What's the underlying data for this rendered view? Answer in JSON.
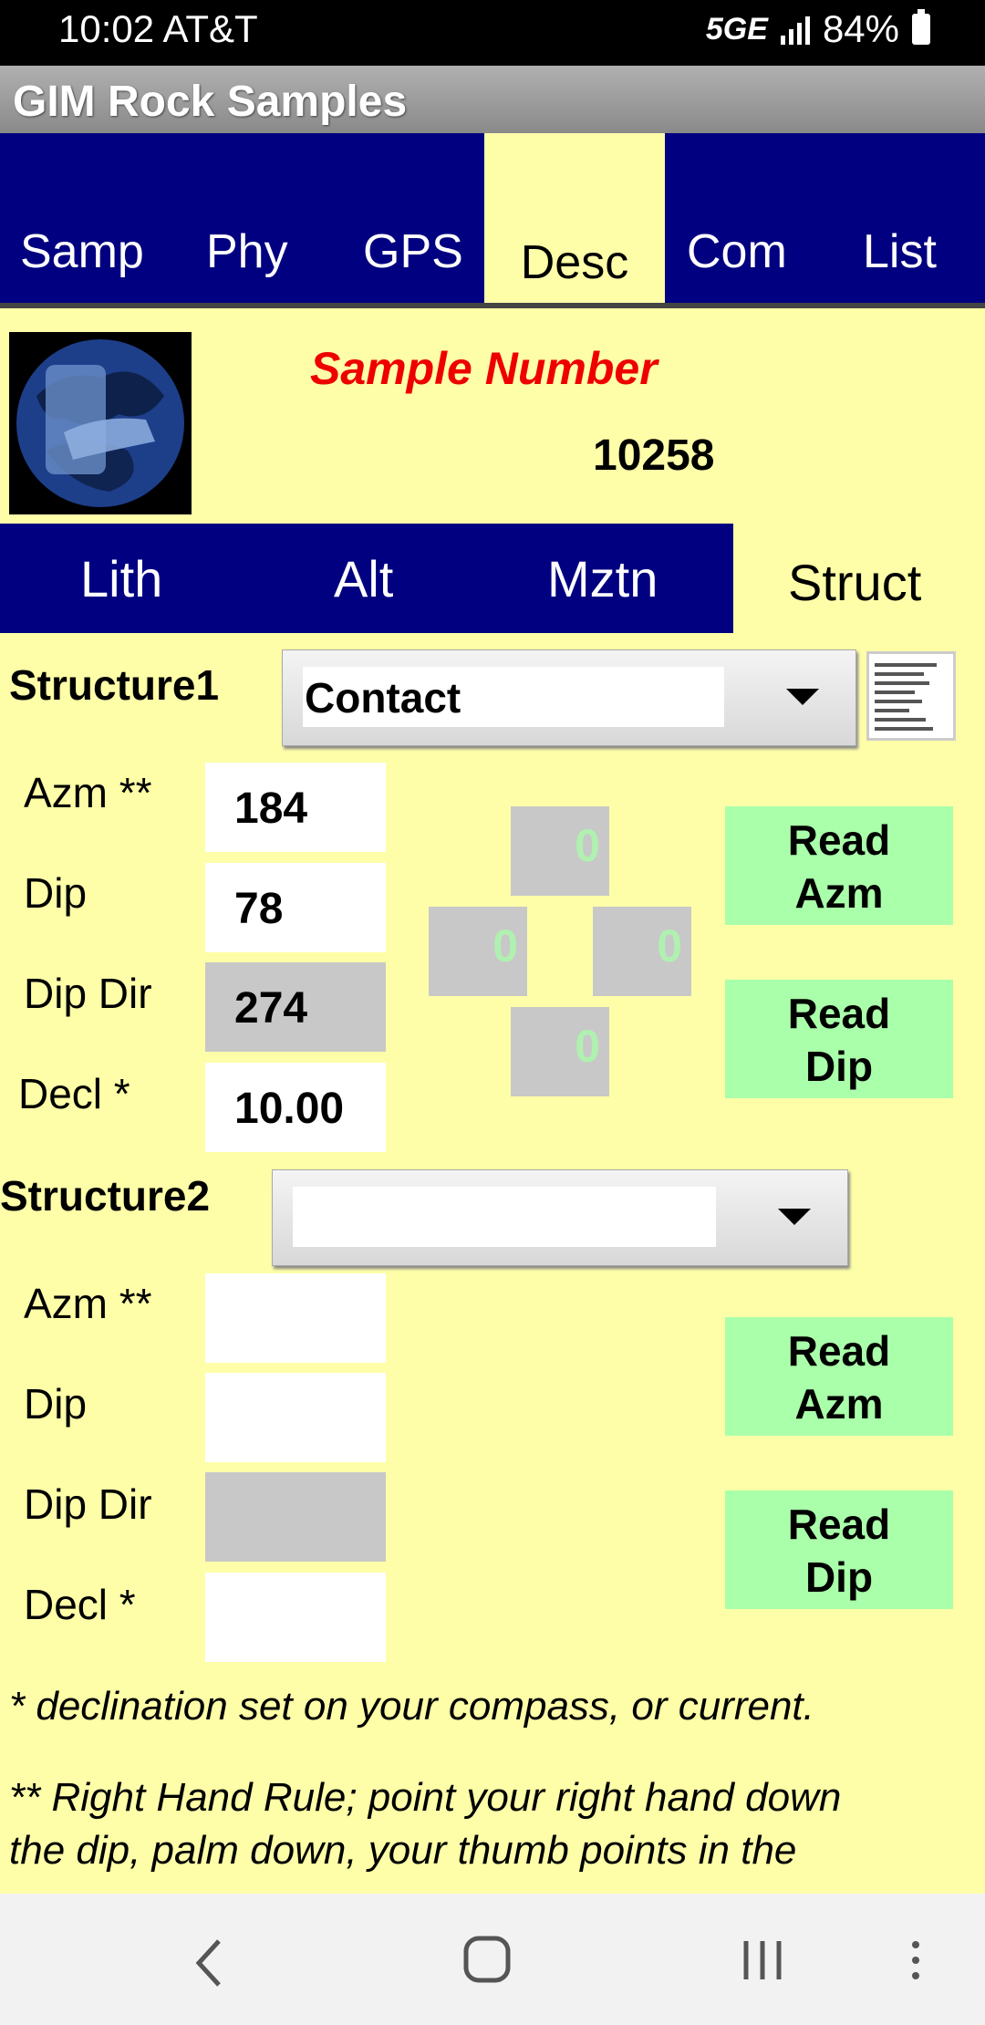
{
  "status": {
    "time": "10:02 AT&T",
    "network": "5GE",
    "battery": "84%"
  },
  "app": {
    "title": "GIM Rock Samples"
  },
  "tabs": [
    "Samp",
    "Phy",
    "GPS",
    "Desc",
    "Com",
    "List"
  ],
  "active_tab": "Desc",
  "sample": {
    "label": "Sample Number",
    "number": "10258"
  },
  "subtabs": [
    "Lith",
    "Alt",
    "Mztn",
    "Struct"
  ],
  "active_subtab": "Struct",
  "structure1": {
    "label": "Structure1",
    "type": "Contact",
    "azm_label": "Azm **",
    "azm": "184",
    "dip_label": "Dip",
    "dip": "78",
    "dipdir_label": "Dip Dir",
    "dipdir": "274",
    "decl_label": "Decl *",
    "decl": "10.00",
    "compass": {
      "top": "0",
      "left": "0",
      "right": "0",
      "bottom": "0"
    },
    "read_azm": "Read Azm",
    "read_dip": "Read Dip"
  },
  "structure2": {
    "label": "Structure2",
    "type": "",
    "azm_label": "Azm **",
    "azm": "",
    "dip_label": "Dip",
    "dip": "",
    "dipdir_label": "Dip Dir",
    "dipdir": "",
    "decl_label": "Decl *",
    "decl": "",
    "read_azm": "Read Azm",
    "read_dip": "Read Dip"
  },
  "notes": {
    "declination": "* declination set on your compass, or current.",
    "rhr_line1": "** Right Hand Rule; point your right hand down",
    "rhr_line2": "the dip, palm down, your thumb points in the"
  }
}
